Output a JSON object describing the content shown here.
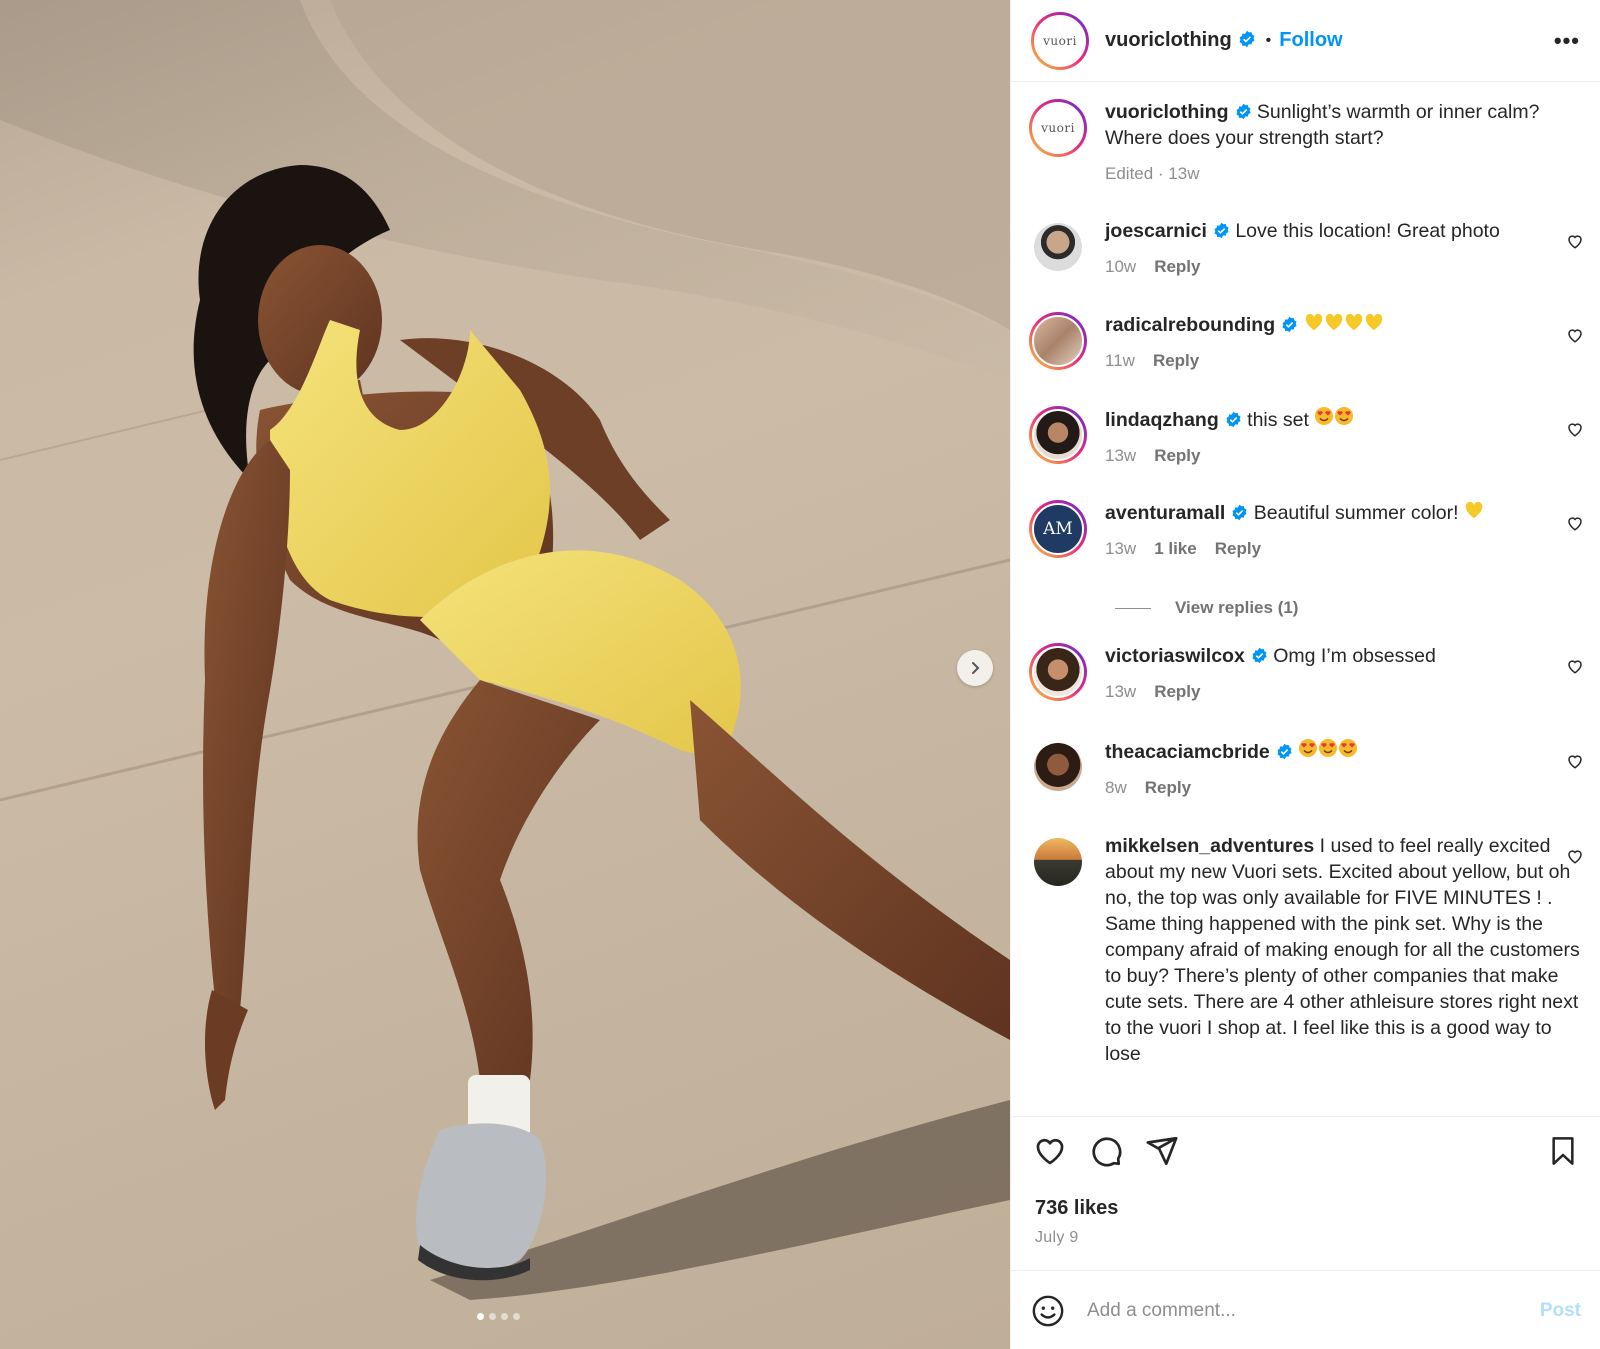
{
  "post": {
    "username": "vuoriclothing",
    "logo_text": "vuori",
    "follow_label": "Follow",
    "separator": "•",
    "more_label": "•••"
  },
  "caption": {
    "username": "vuoriclothing",
    "text": "Sunlight’s warmth or inner calm? Where does your strength start?",
    "meta": "Edited · 13w"
  },
  "comments": [
    {
      "username": "joescarnici",
      "verified": true,
      "text": "Love this location! Great photo",
      "time": "10w",
      "likes": "",
      "reply": "Reply"
    },
    {
      "username": "radicalrebounding",
      "verified": true,
      "text": "",
      "emoji": "yellow-heart x4",
      "time": "11w",
      "likes": "",
      "reply": "Reply"
    },
    {
      "username": "lindaqzhang",
      "verified": true,
      "text": "this set",
      "emoji": "heart-eyes x2",
      "time": "13w",
      "likes": "",
      "reply": "Reply"
    },
    {
      "username": "aventuramall",
      "verified": true,
      "text": "Beautiful summer color!",
      "emoji": "yellow-heart x1",
      "time": "13w",
      "likes": "1 like",
      "reply": "Reply"
    },
    {
      "username": "victoriaswilcox",
      "verified": true,
      "text": "Omg I’m obsessed",
      "time": "13w",
      "likes": "",
      "reply": "Reply"
    },
    {
      "username": "theacaciamcbride",
      "verified": true,
      "text": "",
      "emoji": "heart-eyes x3",
      "time": "8w",
      "likes": "",
      "reply": "Reply"
    },
    {
      "username": "mikkelsen_adventures",
      "verified": false,
      "text": "I used to feel really excited about my new Vuori sets. Excited about yellow, but oh no, the top was only available for FIVE MINUTES ! . Same thing happened with the pink set. Why is the company afraid of making enough for all the customers to buy? There’s plenty of other companies that make cute sets. There are 4 other athleisure stores right next to the vuori I shop at. I feel like this is a good way to lose"
    }
  ],
  "view_replies": "View replies (1)",
  "footer": {
    "likes": "736 likes",
    "date": "July 9",
    "comment_placeholder": "Add a comment...",
    "post_label": "Post"
  },
  "carousel": {
    "slides": 4,
    "active": 1
  },
  "colors": {
    "follow": "#0095f6",
    "verified": "#0095f6",
    "post_disabled": "#b2dffc",
    "outfit": "#f0d85a"
  }
}
